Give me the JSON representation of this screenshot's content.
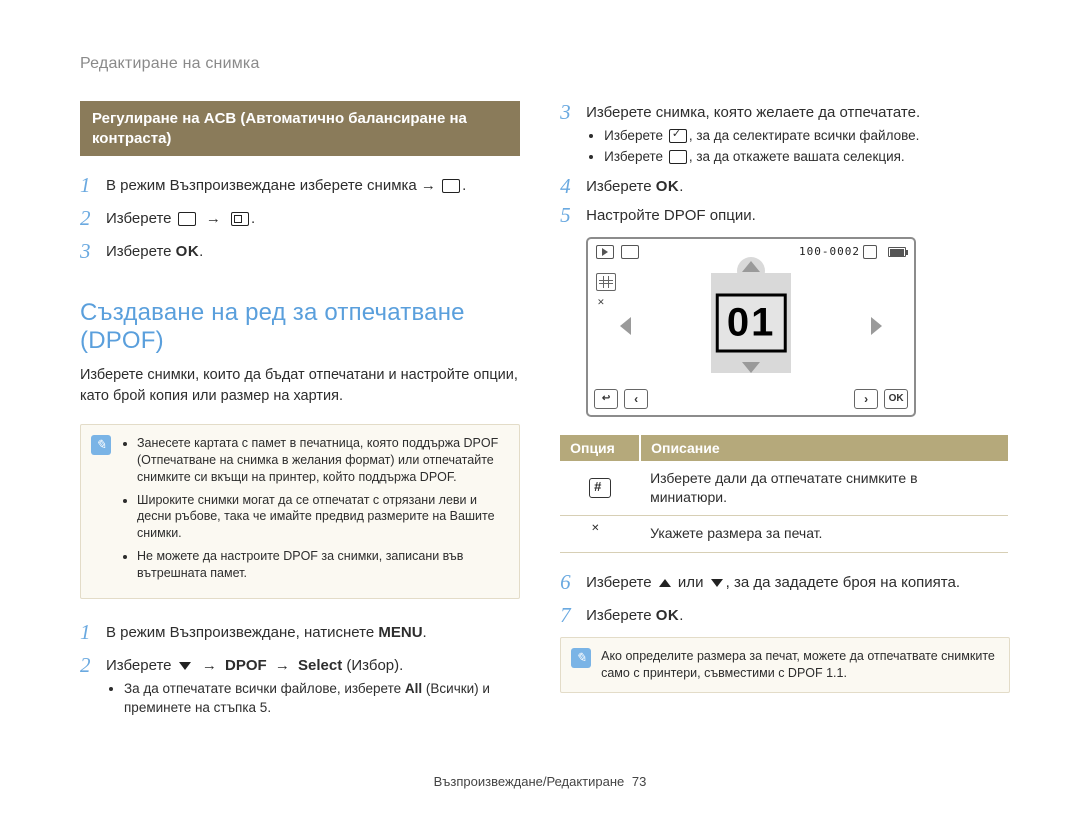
{
  "header": {
    "title": "Редактиране на снимка"
  },
  "left": {
    "banner": "Регулиране на ACB (Автоматично балансиране на контраста)",
    "stepsA": {
      "s1_pre": "В режим Възпроизвеждане изберете снимка →",
      "s2": "Изберете",
      "s3_pre": "Изберете",
      "s3_ok": "OK"
    },
    "section_title": "Създаване на ред за отпечатване (DPOF)",
    "section_sub": "Изберете снимки, които да бъдат отпечатани и настройте опции, като брой копия или размер на хартия.",
    "note1": {
      "b1": "Занесете картата с памет в печатница, която поддържа DPOF (Отпечатване на снимка в желания формат) или отпечатайте снимките си вкъщи на принтер, който поддържа DPOF.",
      "b2": "Широките снимки могат да се отпечатат с отрязани леви и десни ръбове, така че имайте предвид размерите на Вашите снимки.",
      "b3": "Не можете да настроите DPOF за снимки, записани във вътрешната памет."
    },
    "stepsB": {
      "s1_pre": "В режим Възпроизвеждане, натиснете ",
      "s1_menu": "MENU",
      "s1_post": ".",
      "s2_pre": "Изберете ",
      "s2_dpof": "DPOF",
      "s2_select": "Select",
      "s2_izbor": " (Избор).",
      "s2_sub_pre": "За да отпечатате всички файлове, изберете ",
      "s2_sub_all": "All",
      "s2_sub_post": " (Всички) и преминете на стъпка 5."
    }
  },
  "right": {
    "s3_text": "Изберете снимка, която желаете да отпечатате.",
    "s3_b1_pre": "Изберете ",
    "s3_b1_post": ", за да селектирате всички файлове.",
    "s3_b2_pre": "Изберете ",
    "s3_b2_post": ", за да откажете вашата селекция.",
    "s4_pre": "Изберете ",
    "s4_ok": "OK",
    "s4_post": ".",
    "s5": "Настройте DPOF опции.",
    "preview": {
      "counter": "100-0002",
      "big_num": "01",
      "ok": "OK"
    },
    "table": {
      "th1": "Опция",
      "th2": "Описание",
      "r1": "Изберете дали да отпечатате снимките в миниатюри.",
      "r2": "Укажете размера за печат."
    },
    "s6_pre": "Изберете ",
    "s6_mid": " или ",
    "s6_post": ", за да зададете броя на копията.",
    "s7_pre": "Изберете ",
    "s7_ok": "OK",
    "s7_post": ".",
    "note2": "Ако определите размера за печат, можете да отпечатвате снимките само с принтери, съвместими с DPOF 1.1."
  },
  "footer": {
    "text": "Възпроизвеждане/Редактиране",
    "page": "73"
  }
}
